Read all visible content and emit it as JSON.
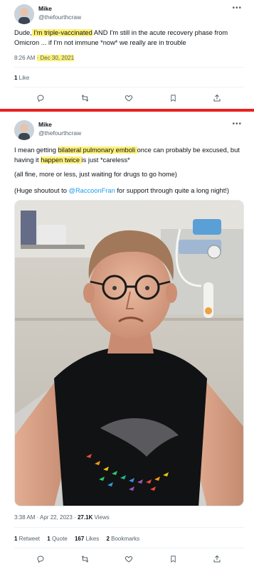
{
  "tweet1": {
    "author_name": "Mike",
    "author_handle": "@thefourthcraw",
    "text_pre": "Dude,",
    "text_hl1": " I'm triple-vaccinated",
    "text_post": " AND I'm still in the acute recovery phase from Omicron ... if I'm not immune *now* we really are in trouble",
    "time": "8:26 AM",
    "date": "· Dec 30, 2021",
    "likes_count": "1",
    "likes_label": " Like"
  },
  "tweet2": {
    "author_name": "Mike",
    "author_handle": "@thefourthcraw",
    "p1_a": "I mean getting ",
    "p1_hl1": "bilateral pulmonary emboli ",
    "p1_b": "once can probably be excused, but having it ",
    "p1_hl2": "happen twice ",
    "p1_c": "is just *careless*",
    "p2": "(all fine, more or less, just waiting for drugs to go home)",
    "p3_a": "(Huge shoutout to ",
    "p3_link": "@RaccoonFran",
    "p3_b": " for support through quite a long night!)",
    "time": "3:38 AM · Apr 22, 2023 · ",
    "views_count": "27.1K",
    "views_label": " Views",
    "retweets_count": "1",
    "retweets_label": " Retweet",
    "quotes_count": "1",
    "quotes_label": " Quote",
    "likes_count": "167",
    "likes_label": " Likes",
    "bookmarks_count": "2",
    "bookmarks_label": " Bookmarks"
  },
  "colors": {
    "highlight": "#fff176",
    "link": "#1d9bf0",
    "separator": "#e8201d",
    "muted": "#536471"
  },
  "icons": [
    "reply-icon",
    "retweet-icon",
    "like-icon",
    "bookmark-icon",
    "share-icon",
    "more-icon"
  ]
}
